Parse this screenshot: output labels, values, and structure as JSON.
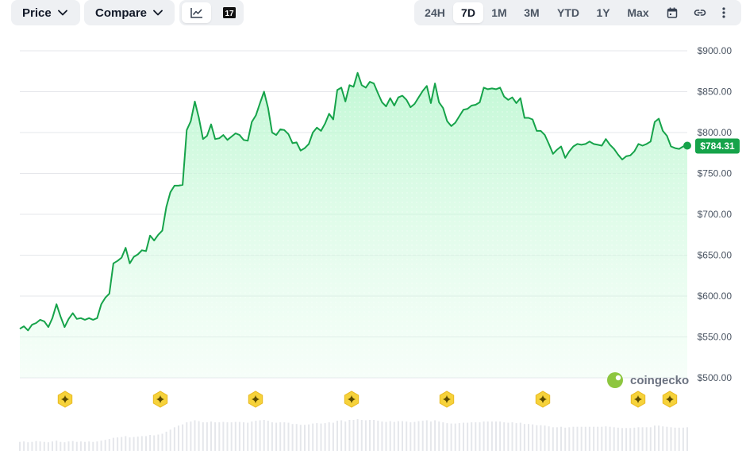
{
  "toolbar": {
    "price_label": "Price",
    "compare_label": "Compare",
    "line_chart_icon": "line-chart-icon",
    "tradingview_icon": "tradingview-logo",
    "tradingview_text": "17",
    "ranges": [
      "24H",
      "7D",
      "1M",
      "3M",
      "YTD",
      "1Y",
      "Max"
    ],
    "active_range": "7D",
    "calendar_icon": "calendar-icon",
    "link_icon": "link-icon",
    "more_icon": "more-vertical-icon"
  },
  "watermark": {
    "text": "coingecko"
  },
  "colors": {
    "line": "#16a34a",
    "fill_top": "#bbf7d0",
    "grid": "#e5e7eb",
    "event_marker": "#f6d23a",
    "badge": "#16a34a"
  },
  "chart_data": {
    "type": "area",
    "title": "",
    "current_price_label": "$784.31",
    "ylim": [
      500,
      900
    ],
    "y_ticks": [
      900,
      850,
      800,
      750,
      700,
      650,
      600,
      550,
      500
    ],
    "y_tick_labels": [
      "$900.00",
      "$850.00",
      "$800.00",
      "$750.00",
      "$700.00",
      "$650.00",
      "$600.00",
      "$550.00",
      "$500.00"
    ],
    "grid": true,
    "event_marker_count": 8,
    "series": [
      {
        "values": [
          560,
          563,
          558,
          565,
          567,
          571,
          569,
          562,
          573,
          590,
          575,
          562,
          572,
          579,
          572,
          573,
          571,
          573,
          571,
          573,
          590,
          598,
          603,
          640,
          643,
          647,
          659,
          640,
          648,
          651,
          656,
          655,
          674,
          668,
          675,
          680,
          709,
          727,
          735,
          735,
          736,
          803,
          814,
          838,
          818,
          792,
          796,
          810,
          792,
          793,
          797,
          791,
          795,
          799,
          797,
          791,
          790,
          813,
          821,
          836,
          850,
          830,
          800,
          797,
          804,
          803,
          798,
          787,
          788,
          778,
          781,
          786,
          800,
          806,
          802,
          811,
          823,
          816,
          852,
          855,
          838,
          858,
          856,
          873,
          858,
          855,
          862,
          860,
          848,
          837,
          832,
          842,
          833,
          843,
          845,
          840,
          831,
          835,
          843,
          851,
          857,
          836,
          860,
          837,
          830,
          814,
          808,
          812,
          820,
          828,
          829,
          833,
          834,
          837,
          855,
          853,
          854,
          853,
          855,
          844,
          840,
          843,
          836,
          842,
          818,
          818,
          816,
          802,
          802,
          797,
          786,
          774,
          779,
          783,
          769,
          777,
          783,
          786,
          785,
          786,
          789,
          786,
          785,
          784,
          792,
          785,
          780,
          773,
          767,
          771,
          772,
          777,
          786,
          784,
          786,
          789,
          813,
          817,
          802,
          796,
          783,
          781,
          780,
          783,
          784
        ]
      }
    ],
    "volume_bars": [
      22,
      23,
      21,
      22,
      24,
      23,
      22,
      21,
      23,
      25,
      22,
      21,
      23,
      24,
      22,
      23,
      22,
      23,
      22,
      23,
      25,
      27,
      29,
      32,
      33,
      34,
      36,
      33,
      34,
      35,
      36,
      36,
      39,
      38,
      40,
      42,
      47,
      52,
      58,
      62,
      65,
      70,
      72,
      75,
      73,
      70,
      70,
      72,
      70,
      70,
      71,
      70,
      70,
      71,
      71,
      70,
      69,
      72,
      74,
      75,
      76,
      74,
      70,
      69,
      70,
      70,
      69,
      66,
      66,
      64,
      64,
      65,
      67,
      68,
      67,
      68,
      70,
      69,
      74,
      75,
      72,
      76,
      76,
      78,
      76,
      75,
      76,
      76,
      74,
      72,
      71,
      73,
      71,
      73,
      73,
      72,
      70,
      71,
      73,
      74,
      75,
      72,
      75,
      72,
      70,
      68,
      67,
      67,
      68,
      69,
      69,
      70,
      70,
      70,
      72,
      72,
      72,
      72,
      72,
      70,
      69,
      70,
      68,
      69,
      66,
      66,
      65,
      63,
      63,
      62,
      60,
      58,
      58,
      59,
      57,
      58,
      59,
      59,
      59,
      59,
      59,
      59,
      59,
      59,
      60,
      59,
      58,
      57,
      56,
      56,
      56,
      57,
      58,
      58,
      58,
      58,
      62,
      62,
      60,
      59,
      58,
      57,
      57,
      57,
      58
    ]
  }
}
